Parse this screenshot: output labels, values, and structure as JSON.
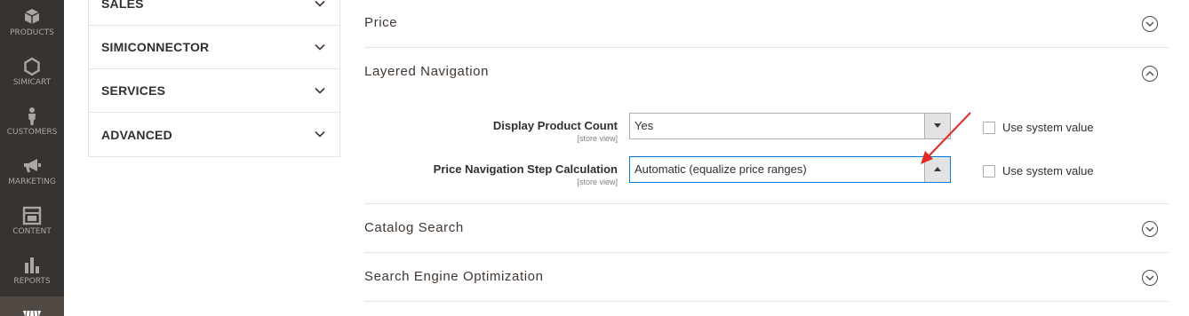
{
  "admin_nav": {
    "items": [
      {
        "label": "PRODUCTS",
        "icon": "cube-icon"
      },
      {
        "label": "SIMICART",
        "icon": "hexagon-icon"
      },
      {
        "label": "CUSTOMERS",
        "icon": "person-icon"
      },
      {
        "label": "MARKETING",
        "icon": "megaphone-icon"
      },
      {
        "label": "CONTENT",
        "icon": "layout-icon"
      },
      {
        "label": "REPORTS",
        "icon": "bar-chart-icon"
      }
    ]
  },
  "config_tabs": [
    {
      "label": "SALES"
    },
    {
      "label": "SIMICONNECTOR"
    },
    {
      "label": "SERVICES"
    },
    {
      "label": "ADVANCED"
    }
  ],
  "sections": {
    "price": {
      "title": "Price",
      "state": "collapsed"
    },
    "layered_navigation": {
      "title": "Layered Navigation",
      "state": "expanded",
      "fields": {
        "display_product_count": {
          "label": "Display Product Count",
          "scope": "[store view]",
          "value": "Yes",
          "use_system_value_label": "Use system value"
        },
        "price_step": {
          "label": "Price Navigation Step Calculation",
          "scope": "[store view]",
          "value": "Automatic (equalize price ranges)",
          "use_system_value_label": "Use system value"
        }
      }
    },
    "catalog_search": {
      "title": "Catalog Search",
      "state": "collapsed"
    },
    "seo": {
      "title": "Search Engine Optimization",
      "state": "collapsed"
    }
  },
  "colors": {
    "nav_bg": "#373330",
    "focus_border": "#007bdb",
    "annotation_arrow": "#e02b27"
  }
}
